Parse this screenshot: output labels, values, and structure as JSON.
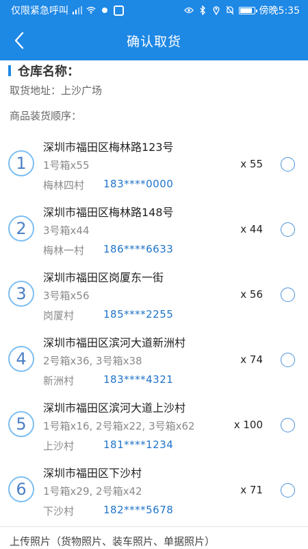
{
  "status_bar": {
    "carrier": "仅限紧急呼叫",
    "time": "傍晚5:35",
    "battery_level": 0.9
  },
  "nav": {
    "title": "确认取货",
    "back_icon": "chevron-left-icon"
  },
  "warehouse": {
    "label": "仓库名称：",
    "pickup_address": "取货地址：上沙广场",
    "order_label": "商品装货顺序："
  },
  "stops": [
    {
      "num": "1",
      "address": "深圳市福田区梅林路123号",
      "boxes": "1号箱x55",
      "village": "梅林四村",
      "phone": "183****0000",
      "count": "x 55"
    },
    {
      "num": "2",
      "address": "深圳市福田区梅林路148号",
      "boxes": "3号箱x44",
      "village": "梅林一村",
      "phone": "186****6633",
      "count": "x 44"
    },
    {
      "num": "3",
      "address": "深圳市福田区岗厦东一街",
      "boxes": "3号箱x56",
      "village": "岗厦村",
      "phone": "185****2255",
      "count": "x 56"
    },
    {
      "num": "4",
      "address": "深圳市福田区滨河大道新洲村",
      "boxes": "2号箱x36, 3号箱x38",
      "village": "新洲村",
      "phone": "183****4321",
      "count": "x 74"
    },
    {
      "num": "5",
      "address": "深圳市福田区滨河大道上沙村",
      "boxes": "1号箱x16, 2号箱x22, 3号箱x62",
      "village": "上沙村",
      "phone": "181****1234",
      "count": "x 100"
    },
    {
      "num": "6",
      "address": "深圳市福田区下沙村",
      "boxes": "1号箱x29, 2号箱x42",
      "village": "下沙村",
      "phone": "182****5678",
      "count": "x 71"
    }
  ],
  "upload": {
    "label": "上传照片（货物照片、装车照片、单据照片）"
  },
  "colors": {
    "primary": "#1e88e5",
    "phone": "#1e73c8",
    "circle_border": "#7bbef3"
  }
}
